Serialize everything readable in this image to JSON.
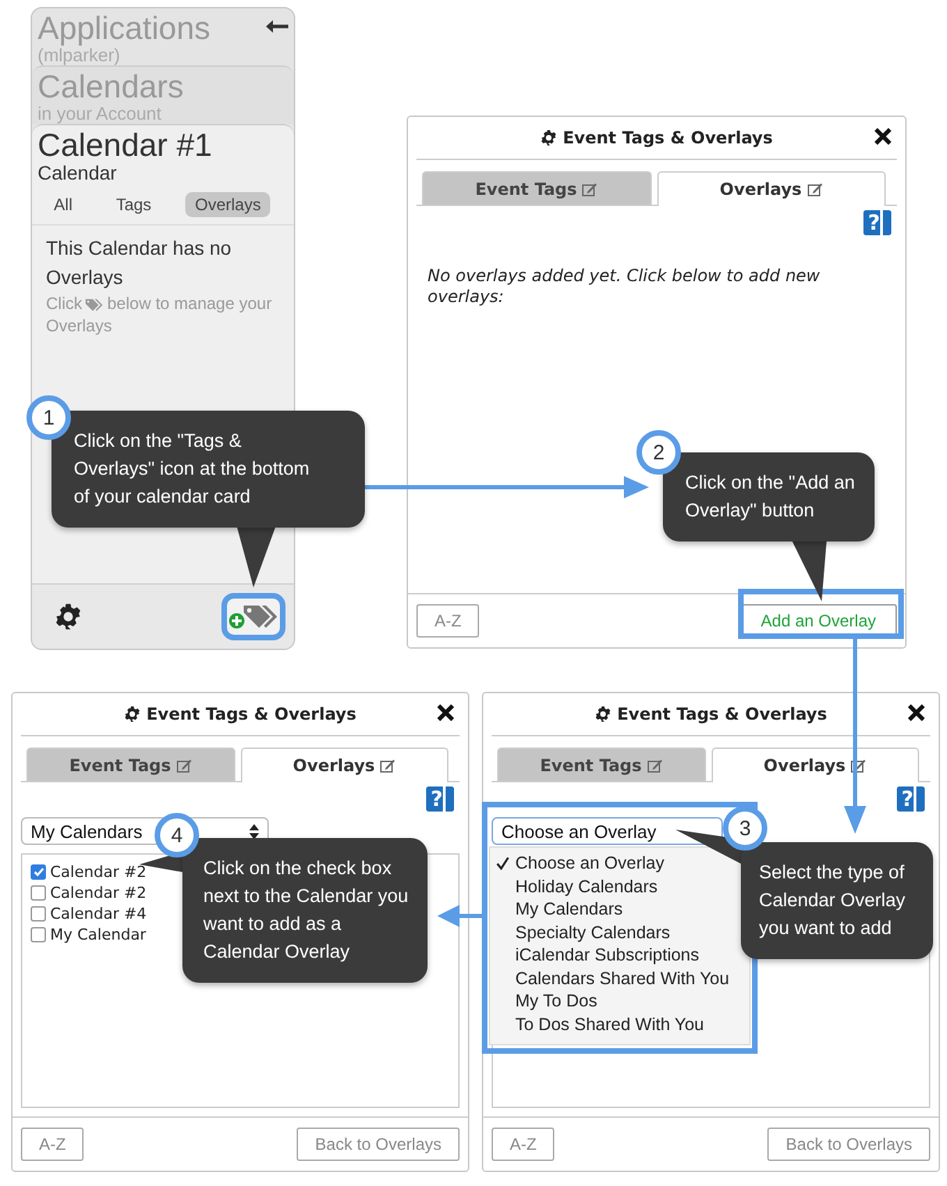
{
  "calendar_card": {
    "levels": [
      {
        "title": "Applications",
        "subtitle": "(mlparker)"
      },
      {
        "title": "Calendars",
        "subtitle": "in your Account"
      }
    ],
    "current": {
      "title": "Calendar #1",
      "subtitle": "Calendar"
    },
    "filters": [
      {
        "label": "All",
        "selected": false
      },
      {
        "label": "Tags",
        "selected": false
      },
      {
        "label": "Overlays",
        "selected": true
      }
    ],
    "message": "This Calendar has no Overlays",
    "hint_start": "Click",
    "hint_middle": "below to manage your",
    "hint_end": "Overlays"
  },
  "dialogs": [
    {
      "kind": "empty",
      "title": "Event Tags & Overlays",
      "help_label": "?",
      "tabs": [
        {
          "label": "Event Tags",
          "selected": false
        },
        {
          "label": "Overlays",
          "selected": true
        }
      ],
      "message": "No overlays added yet. Click below to add new overlays:",
      "sort_button": "A-Z",
      "action_button": {
        "label": "Add an Overlay",
        "kind": "add"
      }
    },
    {
      "kind": "calendar-list",
      "title": "Event Tags & Overlays",
      "help_label": "?",
      "tabs": [
        {
          "label": "Event Tags",
          "selected": false
        },
        {
          "label": "Overlays",
          "selected": true
        }
      ],
      "select_value": "My Calendars",
      "calendars": [
        {
          "label": "Calendar #2",
          "checked": true
        },
        {
          "label": "Calendar #2",
          "checked": false
        },
        {
          "label": "Calendar #4",
          "checked": false
        },
        {
          "label": "My Calendar",
          "checked": false
        }
      ],
      "sort_button": "A-Z",
      "action_button": {
        "label": "Back to Overlays",
        "kind": "back"
      }
    },
    {
      "kind": "overlay-chooser",
      "title": "Event Tags & Overlays",
      "help_label": "?",
      "tabs": [
        {
          "label": "Event Tags",
          "selected": false
        },
        {
          "label": "Overlays",
          "selected": true
        }
      ],
      "select_value": "Choose an Overlay",
      "options": [
        {
          "label": "Choose an Overlay",
          "selected": true
        },
        {
          "label": "Holiday Calendars",
          "selected": false
        },
        {
          "label": "My Calendars",
          "selected": false
        },
        {
          "label": "Specialty Calendars",
          "selected": false
        },
        {
          "label": "iCalendar Subscriptions",
          "selected": false
        },
        {
          "label": "Calendars Shared With You",
          "selected": false
        },
        {
          "label": "My To Dos",
          "selected": false
        },
        {
          "label": "To Dos Shared With You",
          "selected": false
        }
      ],
      "sort_button": "A-Z",
      "action_button": {
        "label": "Back to Overlays",
        "kind": "back"
      }
    }
  ],
  "callouts": [
    {
      "step": "1",
      "text": "Click on the \"Tags & Overlays\" icon at the bottom of your calendar card"
    },
    {
      "step": "2",
      "text": "Click on the \"Add an Overlay\" button"
    },
    {
      "step": "4",
      "text": "Click on the check box next to the Calendar you want to add as a Calendar Overlay"
    },
    {
      "step": "3",
      "text": "Select the type of Calendar Overlay you want to add"
    }
  ]
}
